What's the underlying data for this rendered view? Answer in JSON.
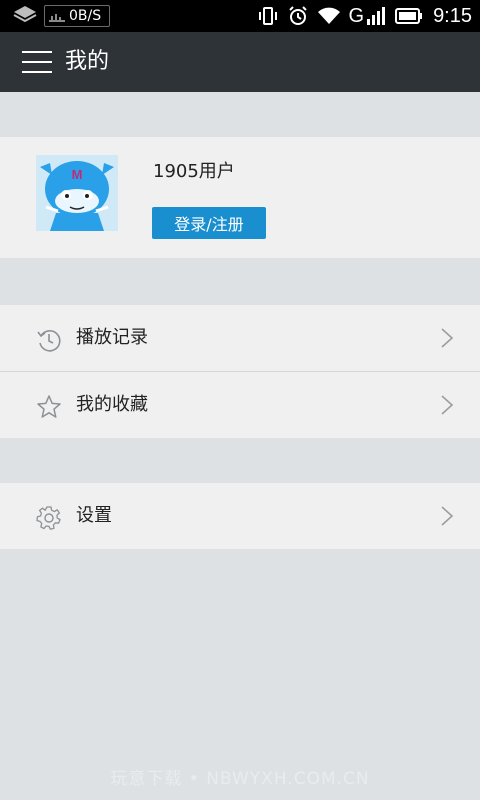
{
  "status_bar": {
    "net_speed": "0B/S",
    "network_label": "G",
    "time": "9:15"
  },
  "action_bar": {
    "title": "我的",
    "menu_icon": "menu-icon"
  },
  "profile": {
    "username": "1905用户",
    "login_button": "登录/注册",
    "avatar_mark": "M"
  },
  "menu": {
    "items": [
      {
        "label": "播放记录",
        "icon": "history-icon"
      },
      {
        "label": "我的收藏",
        "icon": "star-icon"
      },
      {
        "label": "设置",
        "icon": "gear-icon"
      }
    ]
  },
  "watermark": "玩意下载 • NBWYXH.COM.CN",
  "colors": {
    "action_bar": "#2e3338",
    "background": "#dde1e3",
    "card": "#f0f0f0",
    "accent": "#1a8fd0"
  }
}
